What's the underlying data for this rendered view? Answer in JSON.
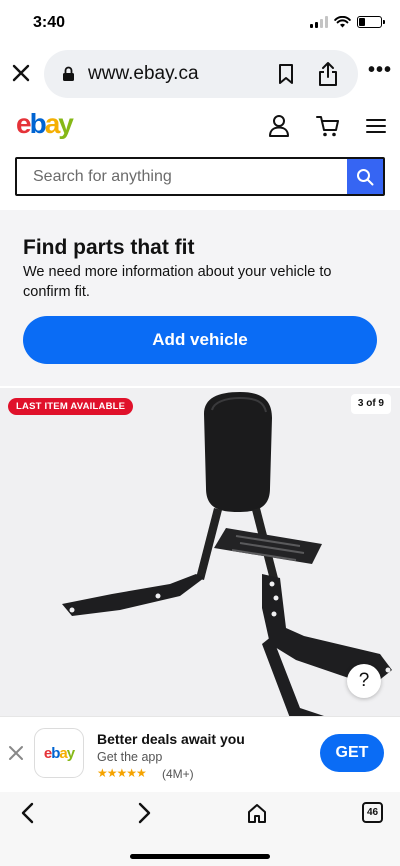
{
  "status_bar": {
    "time": "3:40",
    "battery_level": 0.3,
    "icons": [
      "signal-icon",
      "wifi-icon",
      "battery-icon"
    ]
  },
  "browser": {
    "url": "www.ebay.ca",
    "tabs_count": "46",
    "icons": [
      "close-icon",
      "lock-icon",
      "bookmark-icon",
      "share-icon",
      "more-icon",
      "back-icon",
      "forward-icon",
      "home-icon",
      "tabs-icon"
    ]
  },
  "header": {
    "logo_letters": [
      "e",
      "b",
      "a",
      "y"
    ],
    "logo_colors": [
      "#e53238",
      "#0064d2",
      "#f5af02",
      "#86b817"
    ],
    "icons": [
      "account-icon",
      "cart-icon",
      "menu-icon"
    ]
  },
  "search": {
    "placeholder": "Search for anything",
    "button_color": "#3665f3"
  },
  "parts": {
    "title": "Find parts that fit",
    "description": "We need more information about your vehicle to confirm fit.",
    "button_label": "Add vehicle",
    "button_color": "#0a6cf5"
  },
  "product": {
    "badge": "LAST ITEM AVAILABLE",
    "badge_color": "#e0112b",
    "image_counter": "3 of 9",
    "help_label": "?"
  },
  "app_banner": {
    "app_icon_text": "ebay",
    "title": "Better deals await you",
    "subtitle": "Get the app",
    "stars": "★★★★★",
    "rating_count": "(4M+)",
    "get_label": "GET"
  }
}
